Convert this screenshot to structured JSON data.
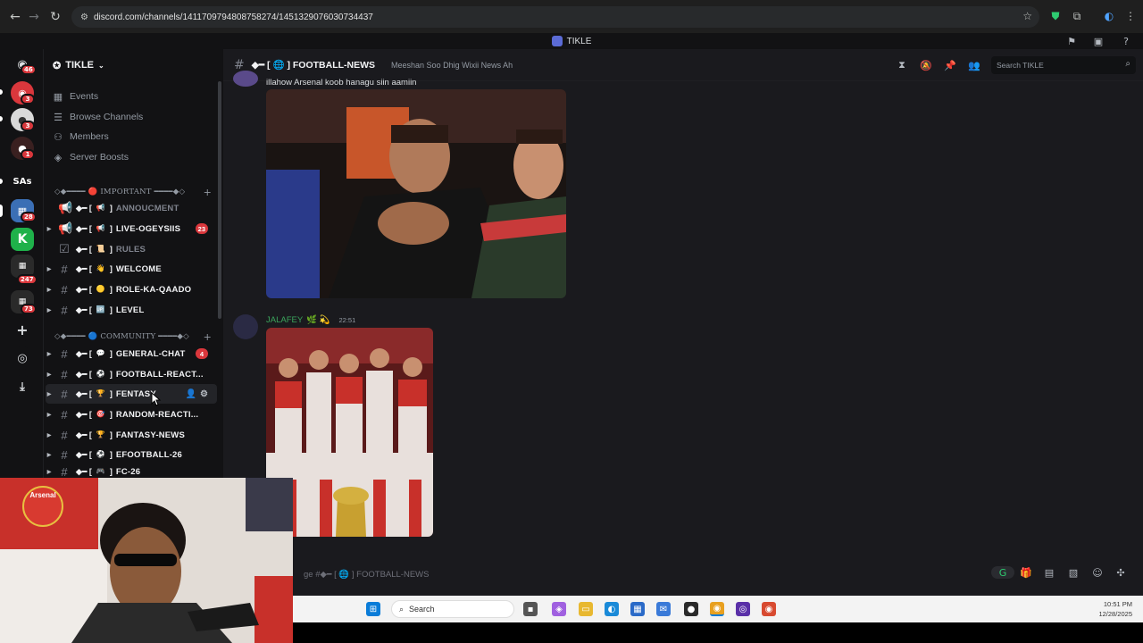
{
  "browser": {
    "url": "discord.com/channels/1411709794808758274/1451329076030734437"
  },
  "discord": {
    "window_title": "TIKLE"
  },
  "rail": {
    "badges": [
      "46",
      "3",
      "3",
      "1",
      "28",
      "247",
      "73"
    ],
    "text_server": "SAs"
  },
  "sidebar": {
    "server_name": "TIKLE",
    "menu": [
      {
        "label": "Events",
        "icon": "calendar-icon"
      },
      {
        "label": "Browse Channels",
        "icon": "browse-icon"
      },
      {
        "label": "Members",
        "icon": "members-icon"
      },
      {
        "label": "Server Boosts",
        "icon": "boost-icon"
      }
    ],
    "categories": [
      {
        "label": "◇◆━━━━ 🔴 IMPORTANT ━━━━◆◇"
      },
      {
        "label": "◇◆━━━━ 🔵 COMMUNITY ━━━━◆◇"
      }
    ],
    "channels": [
      {
        "name": "ANNOUCMENT",
        "icon": "📢",
        "muted": true
      },
      {
        "name": "LIVE-OGEYSIIS",
        "icon": "📢",
        "count": "23"
      },
      {
        "name": "RULES",
        "icon": "📜",
        "muted": true
      },
      {
        "name": "WELCOME",
        "icon": "👋"
      },
      {
        "name": "ROLE-KA-QAADO",
        "icon": "🟡"
      },
      {
        "name": "LEVEL",
        "icon": "🆙"
      },
      {
        "name": "GENERAL-CHAT",
        "icon": "💬",
        "count": "4"
      },
      {
        "name": "FOOTBALL-REACT...",
        "icon": "⚽"
      },
      {
        "name": "FENTASY",
        "icon": "🏆"
      },
      {
        "name": "RANDOM-REACTI...",
        "icon": "🎯"
      },
      {
        "name": "FANTASY-NEWS",
        "icon": "🏆"
      },
      {
        "name": "EFOOTBALL-26",
        "icon": "⚽"
      },
      {
        "name": "FC-26",
        "icon": "🎮"
      }
    ]
  },
  "channel": {
    "name": "◆━ [ 🌐 ] FOOTBALL-NEWS",
    "topic": "Meeshan Soo Dhig Wixii News Ah",
    "search_placeholder": "Search TIKLE"
  },
  "messages": {
    "first_text": "illahow Arsenal koob hanagu siin aamiin",
    "second_author": "JALAFEY",
    "second_author_emoji": "🌿 💫",
    "second_time": "22:51"
  },
  "composer": {
    "placeholder": "ge #◆━ [ 🌐 ] FOOTBALL-NEWS"
  },
  "taskbar": {
    "search_label": "Search",
    "time": "10:51 PM",
    "date": "12/28/2025"
  },
  "colors": {
    "accent_green": "#3ba55c",
    "badge_red": "#da373c",
    "bg_dark": "#1a1a1e"
  }
}
